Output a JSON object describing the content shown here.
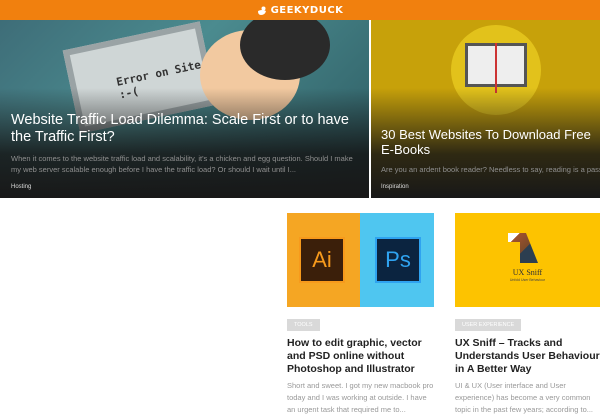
{
  "header": {
    "logo": "GEEKYDUCK",
    "brand_color": "#f1800e"
  },
  "hero": [
    {
      "title": "Website Traffic Load Dilemma: Scale First or to have the Traffic First?",
      "excerpt": "When it comes to the website traffic load and scalability, it's a chicken and egg question. Should I make my web server scalable enough before I have the traffic load? Or should I wait until I...",
      "category": "Hosting",
      "image_text": "Error on Site :-("
    },
    {
      "title": "30 Best Websites To Download Free E-Books",
      "excerpt": "Are you an ardent book reader? Needless to say, reading is a passionate habit that keeps you updated and informed. Thankfully, with the advent of technology, reading is no more limited to books, but...",
      "category": "Inspiration"
    }
  ],
  "cards": [
    {
      "tag": "Tools",
      "title": "How to edit graphic, vector and PSD online without Photoshop and Illustrator",
      "excerpt": "Short and sweet. I got my new macbook pro today and I was working at outside. I have an urgent task that required me to...",
      "ai": "Ai",
      "ps": "Ps"
    },
    {
      "tag": "User Experience",
      "title": "UX Sniff – Tracks and Understands User Behaviour in A Better Way",
      "excerpt": "UI & UX (User interface and User experience) has become a very common topic in the past few years; according to...",
      "logo_title": "UX Sniff",
      "logo_sub": "Unfold User Behaviour"
    }
  ]
}
